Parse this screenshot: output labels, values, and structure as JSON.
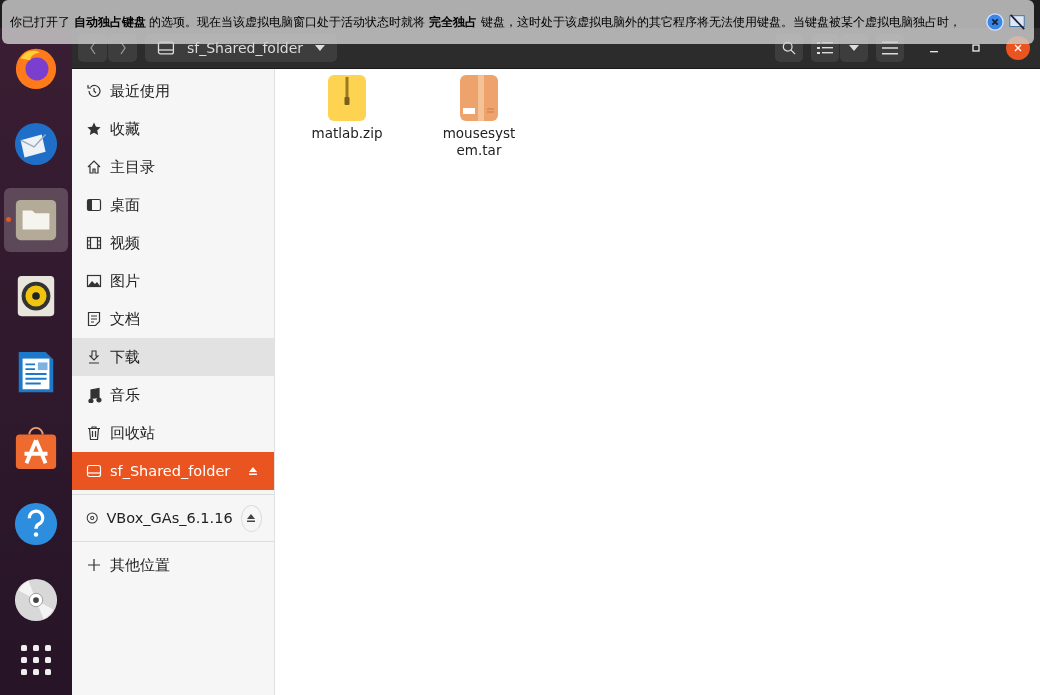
{
  "notification": {
    "parts": [
      "你已打开了 ",
      "**自动独占键盘**",
      " 的选项。现在当该虚拟电脑窗口处于活动状态时就将 ",
      "**完全独占**",
      " 键盘，这时处于该虚拟电脑外的其它程序将无法使用键盘。当键盘被某个虚拟电脑独占时，"
    ]
  },
  "dock": {
    "items": [
      {
        "kind": "firefox",
        "running": false
      },
      {
        "kind": "mail",
        "running": false
      },
      {
        "kind": "files",
        "running": true
      },
      {
        "kind": "speaker",
        "running": false
      },
      {
        "kind": "writer",
        "running": false
      },
      {
        "kind": "store",
        "running": false
      },
      {
        "kind": "help",
        "running": false
      },
      {
        "kind": "disc",
        "running": false
      }
    ]
  },
  "header": {
    "location": "sf_Shared_folder"
  },
  "sidebar": {
    "sections": [
      [
        {
          "kind": "recent",
          "label": "最近使用",
          "selected": false,
          "hovered": false
        },
        {
          "kind": "star",
          "label": "收藏",
          "selected": false,
          "hovered": false
        },
        {
          "kind": "home",
          "label": "主目录",
          "selected": false,
          "hovered": false
        },
        {
          "kind": "desktop",
          "label": "桌面",
          "selected": false,
          "hovered": false
        },
        {
          "kind": "video",
          "label": "视频",
          "selected": false,
          "hovered": false
        },
        {
          "kind": "picture",
          "label": "图片",
          "selected": false,
          "hovered": false
        },
        {
          "kind": "doc",
          "label": "文档",
          "selected": false,
          "hovered": false
        },
        {
          "kind": "download",
          "label": "下载",
          "selected": false,
          "hovered": true
        },
        {
          "kind": "music",
          "label": "音乐",
          "selected": false,
          "hovered": false
        },
        {
          "kind": "trash",
          "label": "回收站",
          "selected": false,
          "hovered": false
        },
        {
          "kind": "drive",
          "label": "sf_Shared_folder",
          "selected": true,
          "hovered": false,
          "ejectable": true
        }
      ],
      [
        {
          "kind": "disc",
          "label": "VBox_GAs_6.1.16",
          "selected": false,
          "hovered": false,
          "ejectable": true
        }
      ],
      [
        {
          "kind": "plus",
          "label": "其他位置",
          "selected": false,
          "hovered": false
        }
      ]
    ]
  },
  "files": [
    {
      "kind": "zip",
      "name": "matlab.zip"
    },
    {
      "kind": "tar",
      "name": "mousesyst\nem.tar"
    }
  ]
}
